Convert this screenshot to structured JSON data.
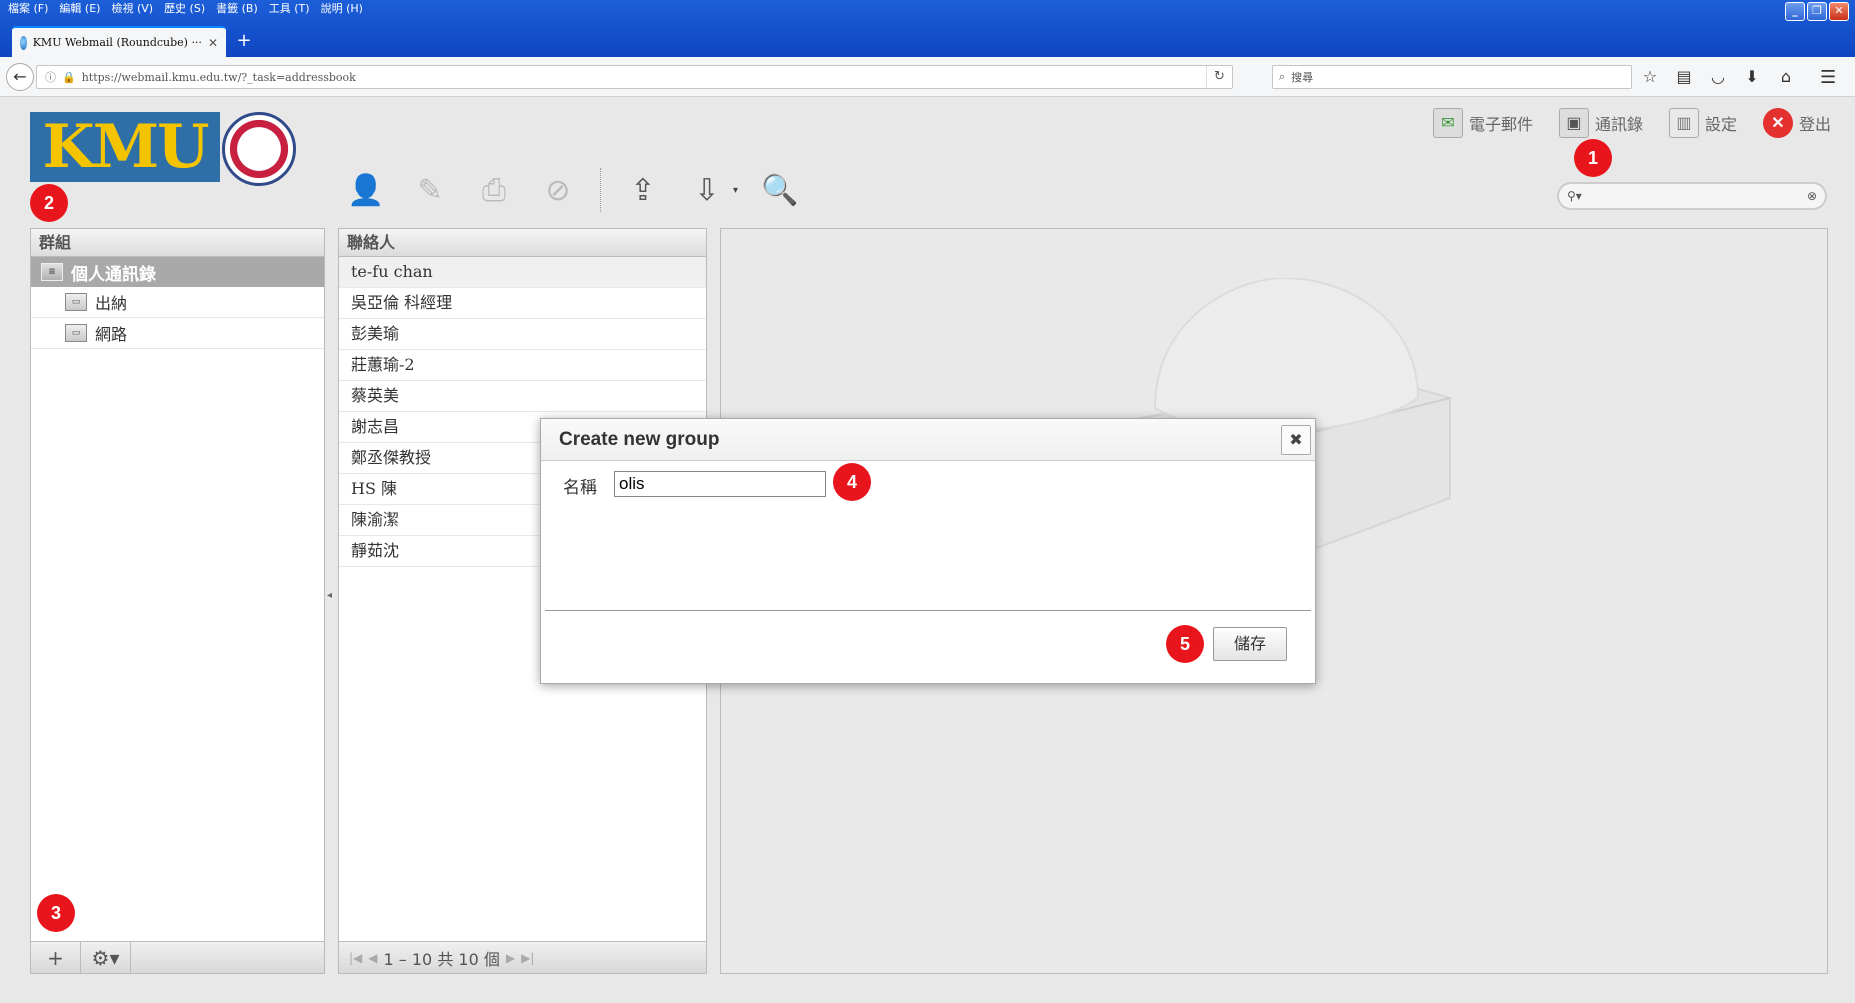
{
  "browser": {
    "menu": [
      "檔案 (F)",
      "編輯 (E)",
      "檢視 (V)",
      "歷史 (S)",
      "書籤 (B)",
      "工具 (T)",
      "說明 (H)"
    ],
    "tab_title": "KMU Webmail (Roundcube) ···",
    "url": "https://webmail.kmu.edu.tw/?_task=addressbook",
    "search_placeholder": "搜尋"
  },
  "app": {
    "logo_text": "KMU",
    "topnav": [
      {
        "label": "電子郵件",
        "icon": "mail-icon"
      },
      {
        "label": "通訊錄",
        "icon": "addressbook-icon"
      },
      {
        "label": "設定",
        "icon": "settings-icon"
      },
      {
        "label": "登出",
        "icon": "logout-icon"
      }
    ],
    "toolbar_icons": [
      "add-contact-icon",
      "edit-contact-icon",
      "print-icon",
      "delete-icon",
      "import-icon",
      "export-icon",
      "search-icon"
    ]
  },
  "badges": [
    "1",
    "2",
    "3",
    "4",
    "5"
  ],
  "groups": {
    "header": "群組",
    "root": "個人通訊錄",
    "items": [
      "出納",
      "網路"
    ]
  },
  "contacts": {
    "header": "聯絡人",
    "items": [
      "te-fu chan",
      "吳亞倫 科經理",
      "彭美瑜",
      "莊蕙瑜-2",
      "蔡英美",
      "謝志昌",
      "鄭丞傑教授",
      "HS 陳",
      "陳渝潔",
      "靜茹沈"
    ],
    "pagination": "1 – 10 共 10 個"
  },
  "dialog": {
    "title": "Create new group",
    "name_label": "名稱",
    "name_value": "olis",
    "save_label": "儲存",
    "close_symbol": "✖"
  },
  "colors": {
    "badge": "#e8161c",
    "firefox_blue": "#1c5fd8",
    "logo_bg": "#2e6fa8",
    "logo_text": "#f5c400",
    "selected_group": "#a9a9a9"
  }
}
